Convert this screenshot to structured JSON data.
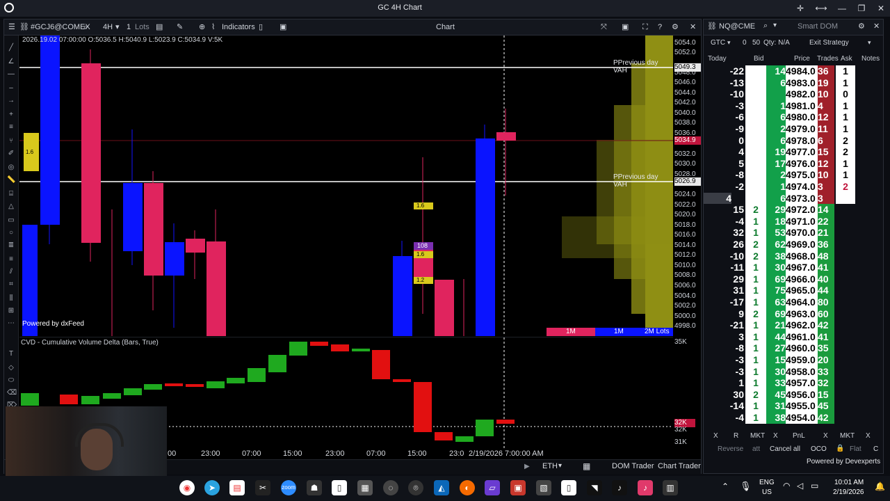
{
  "window": {
    "title": "GC 4H Chart"
  },
  "chart_toolbar": {
    "symbol": "#GCJ6@COMEX",
    "timeframe": "4H",
    "qty": "1",
    "qty_unit": "Lots",
    "indicators_label": "Indicators",
    "center_label": "Chart"
  },
  "ohlc_text": "2026.19.02 07:00:00 O:5036.5 H:5040.9 L:5023.9 C:5034.9 V:5K",
  "level_labels": {
    "vah1": "PPrevious day VAH",
    "vah2": "PPrevious day VAH"
  },
  "price_axis": [
    "5054.0",
    "5052.0",
    "5048.0",
    "5046.0",
    "5044.0",
    "5042.0",
    "5040.0",
    "5038.0",
    "5036.0",
    "5032.0",
    "5030.0",
    "5028.0",
    "5024.0",
    "5022.0",
    "5020.0",
    "5018.0",
    "5016.0",
    "5014.0",
    "5012.0",
    "5010.0",
    "5008.0",
    "5006.0",
    "5004.0",
    "5002.0",
    "5000.0",
    "4998.0"
  ],
  "price_tags": {
    "vah_top": "5049.3",
    "current": "5034.9",
    "vah_bottom": "5026.9"
  },
  "volume_bar_labels": [
    "1M",
    "1M",
    "2M Lots"
  ],
  "watermark": "Powered by dxFeed",
  "cluster_labels": {
    "c1": "1.6",
    "c2": "108",
    "c3": "1.6",
    "c4": "1.2",
    "c5": "1.6"
  },
  "cvd": {
    "title": "CVD - Cumulative Volume Delta (Bars, True)",
    "axis": [
      "35K",
      "32K",
      "31K"
    ],
    "tag": "32K"
  },
  "time_axis": [
    ":00",
    "23:00",
    "07:00",
    "15:00",
    "23:00",
    "07:00",
    "15:00",
    "23:0"
  ],
  "time_cursor": "2/19/2026 7:00:00 AM",
  "bottom_bar": {
    "session": "ETH",
    "dom_trader": "DOM Trader",
    "chart_trader": "Chart Trader"
  },
  "dom": {
    "symbol": "NQ@CME",
    "title": "Smart DOM",
    "tif": "GTC",
    "qty_zero": "0",
    "qty_value": "50",
    "qty_label": "Qty: N/A",
    "strategy": "Exit Strategy",
    "headers": [
      "Today",
      "Bid",
      "Price",
      "Trades",
      "Ask",
      "Notes"
    ],
    "rows": [
      {
        "today": "-22",
        "bid": "",
        "vol": "14",
        "price": "4984.0",
        "trades": "36",
        "ask": "1"
      },
      {
        "today": "-13",
        "bid": "",
        "vol": "6",
        "price": "4983.0",
        "trades": "19",
        "ask": "1"
      },
      {
        "today": "-10",
        "bid": "",
        "vol": "",
        "price": "4982.0",
        "trades": "10",
        "ask": "0"
      },
      {
        "today": "-3",
        "bid": "",
        "vol": "1",
        "price": "4981.0",
        "trades": "4",
        "ask": "1"
      },
      {
        "today": "-6",
        "bid": "",
        "vol": "6",
        "price": "4980.0",
        "trades": "12",
        "ask": "1"
      },
      {
        "today": "-9",
        "bid": "",
        "vol": "2",
        "price": "4979.0",
        "trades": "11",
        "ask": "1"
      },
      {
        "today": "0",
        "bid": "",
        "vol": "6",
        "price": "4978.0",
        "trades": "6",
        "ask": "2"
      },
      {
        "today": "4",
        "bid": "",
        "vol": "19",
        "price": "4977.0",
        "trades": "15",
        "ask": "2"
      },
      {
        "today": "5",
        "bid": "",
        "vol": "17",
        "price": "4976.0",
        "trades": "12",
        "ask": "1"
      },
      {
        "today": "-8",
        "bid": "",
        "vol": "2",
        "price": "4975.0",
        "trades": "10",
        "ask": "1"
      },
      {
        "today": "-2",
        "bid": "",
        "vol": "1",
        "price": "4974.0",
        "trades": "3",
        "ask": "2"
      },
      {
        "today": "4",
        "bid": "",
        "vol": "6",
        "price": "4973.0",
        "trades": "3",
        "ask": ""
      },
      {
        "today": "15",
        "bid": "2",
        "vol": "29",
        "price": "4972.0",
        "trades": "14",
        "ask": ""
      },
      {
        "today": "-4",
        "bid": "1",
        "vol": "18",
        "price": "4971.0",
        "trades": "22",
        "ask": ""
      },
      {
        "today": "32",
        "bid": "1",
        "vol": "53",
        "price": "4970.0",
        "trades": "21",
        "ask": ""
      },
      {
        "today": "26",
        "bid": "2",
        "vol": "62",
        "price": "4969.0",
        "trades": "36",
        "ask": ""
      },
      {
        "today": "-10",
        "bid": "2",
        "vol": "38",
        "price": "4968.0",
        "trades": "48",
        "ask": ""
      },
      {
        "today": "-11",
        "bid": "1",
        "vol": "30",
        "price": "4967.0",
        "trades": "41",
        "ask": ""
      },
      {
        "today": "29",
        "bid": "1",
        "vol": "69",
        "price": "4966.0",
        "trades": "40",
        "ask": ""
      },
      {
        "today": "31",
        "bid": "1",
        "vol": "75",
        "price": "4965.0",
        "trades": "44",
        "ask": ""
      },
      {
        "today": "-17",
        "bid": "1",
        "vol": "63",
        "price": "4964.0",
        "trades": "80",
        "ask": ""
      },
      {
        "today": "9",
        "bid": "2",
        "vol": "69",
        "price": "4963.0",
        "trades": "60",
        "ask": ""
      },
      {
        "today": "-21",
        "bid": "1",
        "vol": "21",
        "price": "4962.0",
        "trades": "42",
        "ask": ""
      },
      {
        "today": "3",
        "bid": "1",
        "vol": "44",
        "price": "4961.0",
        "trades": "41",
        "ask": ""
      },
      {
        "today": "-8",
        "bid": "1",
        "vol": "27",
        "price": "4960.0",
        "trades": "35",
        "ask": ""
      },
      {
        "today": "-3",
        "bid": "1",
        "vol": "15",
        "price": "4959.0",
        "trades": "20",
        "ask": ""
      },
      {
        "today": "-3",
        "bid": "1",
        "vol": "30",
        "price": "4958.0",
        "trades": "33",
        "ask": ""
      },
      {
        "today": "1",
        "bid": "1",
        "vol": "33",
        "price": "4957.0",
        "trades": "32",
        "ask": ""
      },
      {
        "today": "30",
        "bid": "2",
        "vol": "45",
        "price": "4956.0",
        "trades": "15",
        "ask": ""
      },
      {
        "today": "-14",
        "bid": "1",
        "vol": "31",
        "price": "4955.0",
        "trades": "45",
        "ask": ""
      },
      {
        "today": "-4",
        "bid": "1",
        "vol": "38",
        "price": "4954.0",
        "trades": "42",
        "ask": ""
      }
    ],
    "footer_row1": [
      "X",
      "R",
      "MKT",
      "X",
      "PnL",
      "X",
      "MKT",
      "X"
    ],
    "footer_row2": [
      "Reverse",
      "att",
      "Cancel all",
      "OCO",
      "Flat",
      "C"
    ],
    "powered": "Powered by Devexperts"
  },
  "taskbar": {
    "lang1": "ENG",
    "lang2": "US",
    "time": "10:01 AM",
    "date": "2/19/2026"
  }
}
